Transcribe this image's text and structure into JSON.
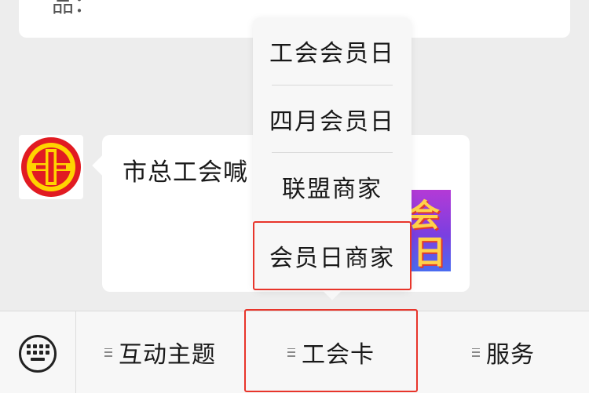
{
  "chat": {
    "previous_card_partial": "品：",
    "message_text": "市总工会喊"
  },
  "avatar": {
    "icon": "trade-union-emblem-icon"
  },
  "thumbnail": {
    "glyph_top": "会",
    "glyph_bottom": "日"
  },
  "popup_menu": {
    "items": [
      {
        "label": "工会会员日"
      },
      {
        "label": "四月会员日"
      },
      {
        "label": "联盟商家"
      },
      {
        "label": "会员日商家"
      }
    ]
  },
  "bottom_menu": {
    "keyboard_icon": "keyboard-icon",
    "menu_indicator_icon": "menu-lines-icon",
    "tabs": [
      {
        "label": "互动主题"
      },
      {
        "label": "工会卡"
      },
      {
        "label": "服务"
      }
    ]
  },
  "colors": {
    "highlight": "#e8352b",
    "emblem_red": "#e11b22",
    "emblem_yellow": "#ffd400",
    "background": "#ededed"
  }
}
